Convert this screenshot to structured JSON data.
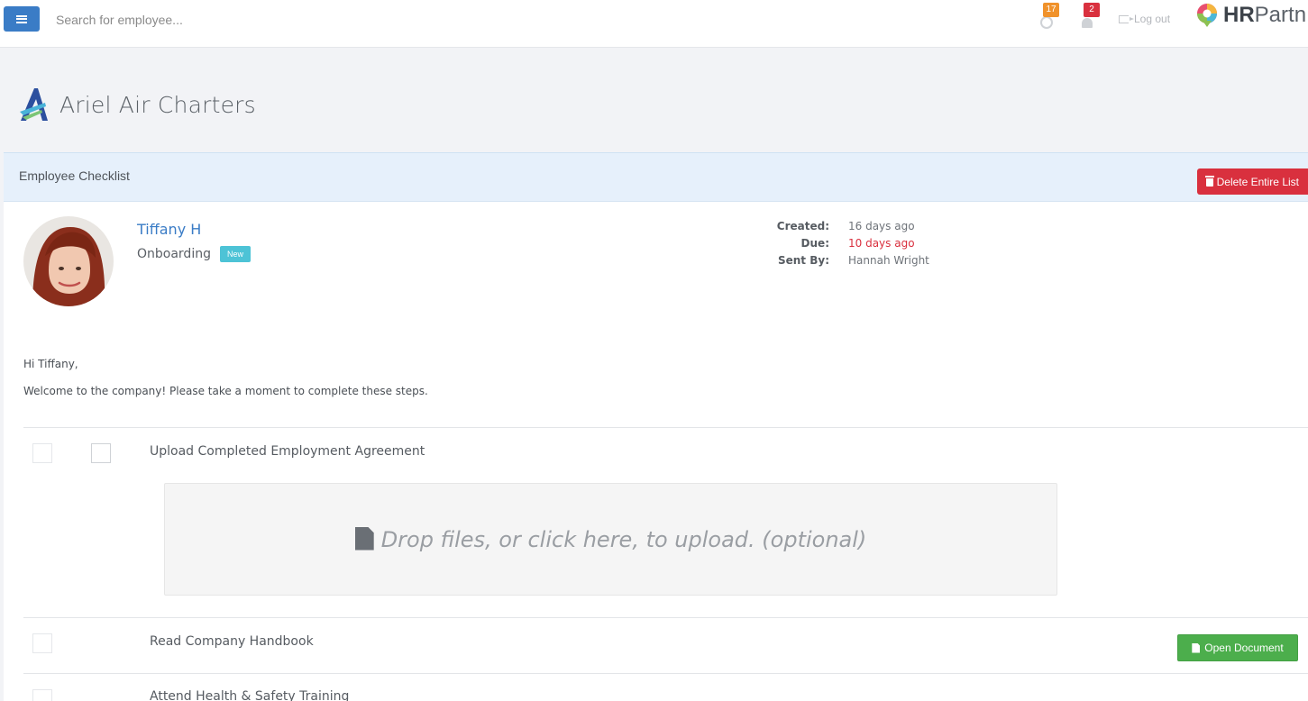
{
  "topbar": {
    "search_placeholder": "Search for employee...",
    "clock_badge": "17",
    "bell_badge": "2",
    "logout_label": "Log out",
    "brand_bold": "HR",
    "brand_rest": "Partn"
  },
  "company": {
    "name": "Ariel Air Charters"
  },
  "panel": {
    "title": "Employee Checklist",
    "delete_label": "Delete Entire List"
  },
  "employee": {
    "name": "Tiffany H",
    "checklist_type": "Onboarding",
    "status_badge": "New"
  },
  "meta": {
    "created_label": "Created:",
    "created_value": "16 days ago",
    "due_label": "Due:",
    "due_value": "10 days ago",
    "sent_by_label": "Sent By:",
    "sent_by_value": "Hannah Wright"
  },
  "message": {
    "greeting": "Hi Tiffany,",
    "body": "Welcome to the company! Please take a moment to complete these steps."
  },
  "tasks": [
    {
      "label": "Upload Completed Employment Agreement"
    },
    {
      "label": "Read Company Handbook"
    },
    {
      "label": "Attend Health & Safety Training"
    }
  ],
  "dropzone": {
    "text": "Drop files, or click here, to upload. (optional)"
  },
  "actions": {
    "open_document_label": "Open Document"
  },
  "colors": {
    "primary": "#3a7cc6",
    "danger": "#d9303e",
    "success": "#4cae4c",
    "info_badge": "#4dc3d6",
    "warning_badge": "#f0922b"
  }
}
